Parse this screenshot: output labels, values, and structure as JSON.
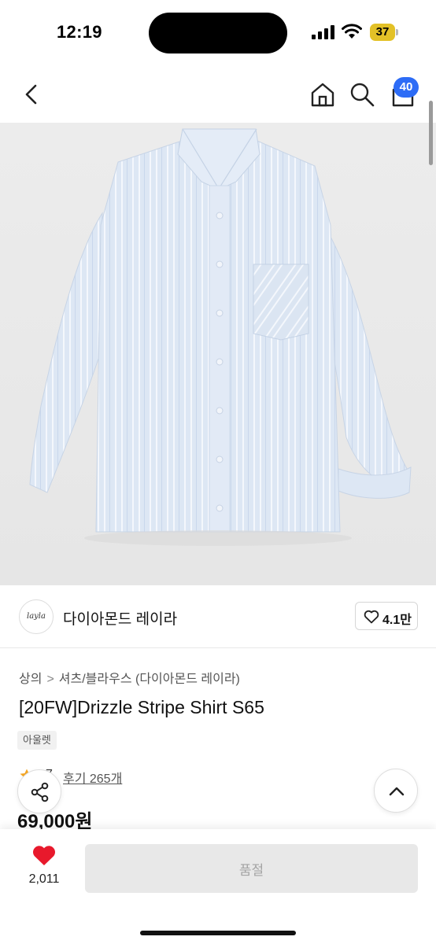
{
  "status_bar": {
    "time": "12:19",
    "battery": "37",
    "signal_icon": "signal-bars-icon",
    "wifi_icon": "wifi-icon",
    "battery_color": "#e3c127"
  },
  "nav": {
    "back_icon": "chevron-left-icon",
    "home_icon": "home-icon",
    "search_icon": "search-icon",
    "cart_icon": "shopping-bag-icon",
    "cart_badge": "40",
    "badge_color": "#2d6cf6"
  },
  "product_image": {
    "subject": "light blue striped long-sleeve shirt"
  },
  "brand": {
    "logo_text": "layla",
    "name": "다이아몬드 레이라",
    "likes": "4.1만"
  },
  "product": {
    "breadcrumb": [
      "상의",
      "셔츠/블라우스 (다이아몬드 레이라)"
    ],
    "title": "[20FW]Drizzle Stripe Shirt S65",
    "tag": "아울렛",
    "rating": "7",
    "reviews": "후기 265개",
    "price": "69,000원"
  },
  "bottom_bar": {
    "wish_count": "2,011",
    "action_label": "품절",
    "heart_color": "#e8192c"
  }
}
